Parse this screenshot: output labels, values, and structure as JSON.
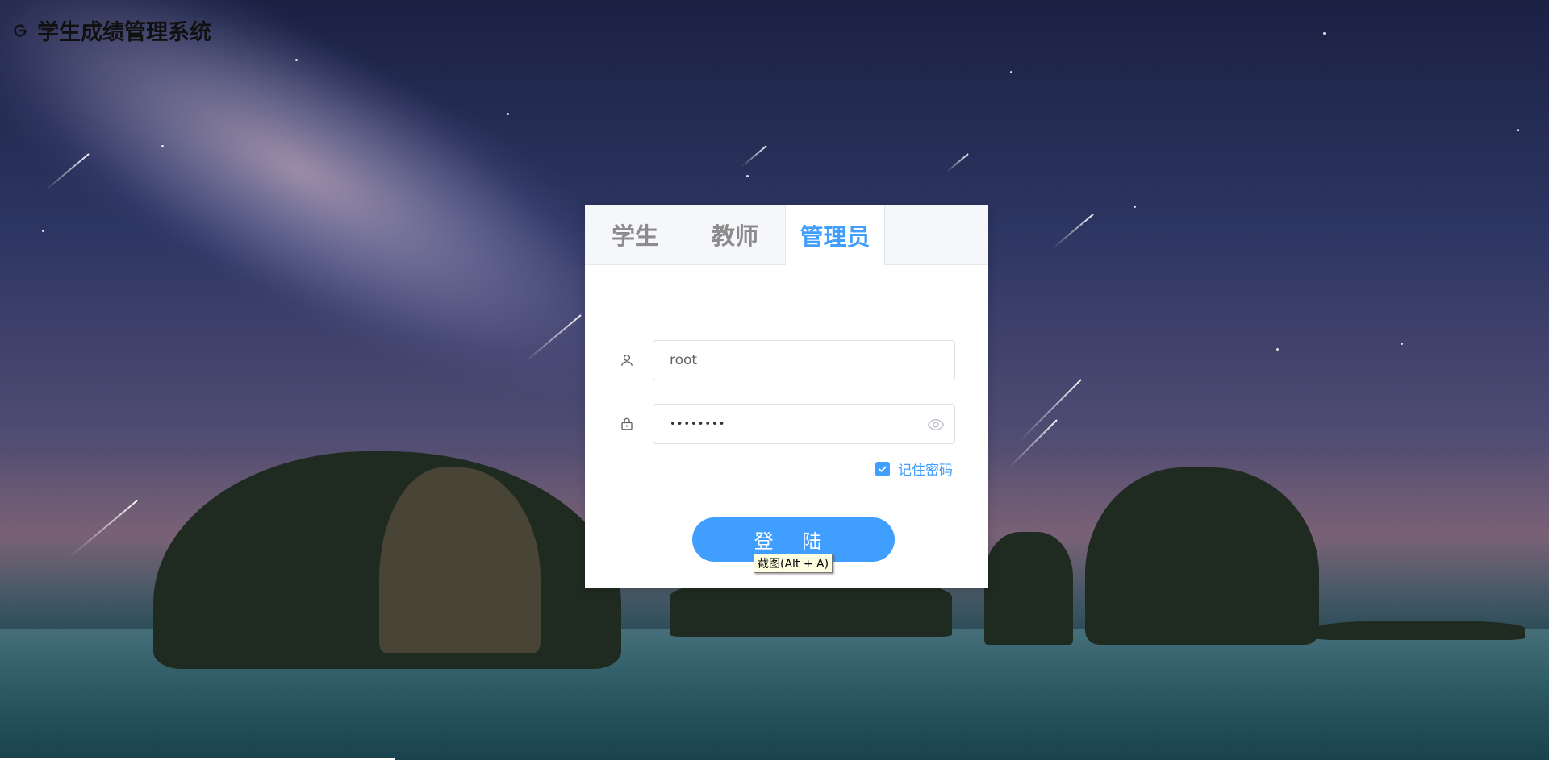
{
  "header": {
    "title": "学生成绩管理系统",
    "logo_icon": "refresh-logo-icon"
  },
  "login": {
    "tabs": [
      {
        "label": "学生",
        "active": false
      },
      {
        "label": "教师",
        "active": false
      },
      {
        "label": "管理员",
        "active": true
      }
    ],
    "username": {
      "value": "root",
      "icon": "user-icon"
    },
    "password": {
      "masked_value": "••••••••",
      "icon": "lock-icon",
      "toggle_icon": "eye-icon"
    },
    "remember": {
      "label": "记住密码",
      "checked": true
    },
    "submit_label": "登 陆",
    "tooltip": "截图(Alt + A)"
  },
  "colors": {
    "accent": "#409eff",
    "tab_inactive": "#8c8c8c",
    "tab_bar_bg": "#f5f7fa"
  }
}
